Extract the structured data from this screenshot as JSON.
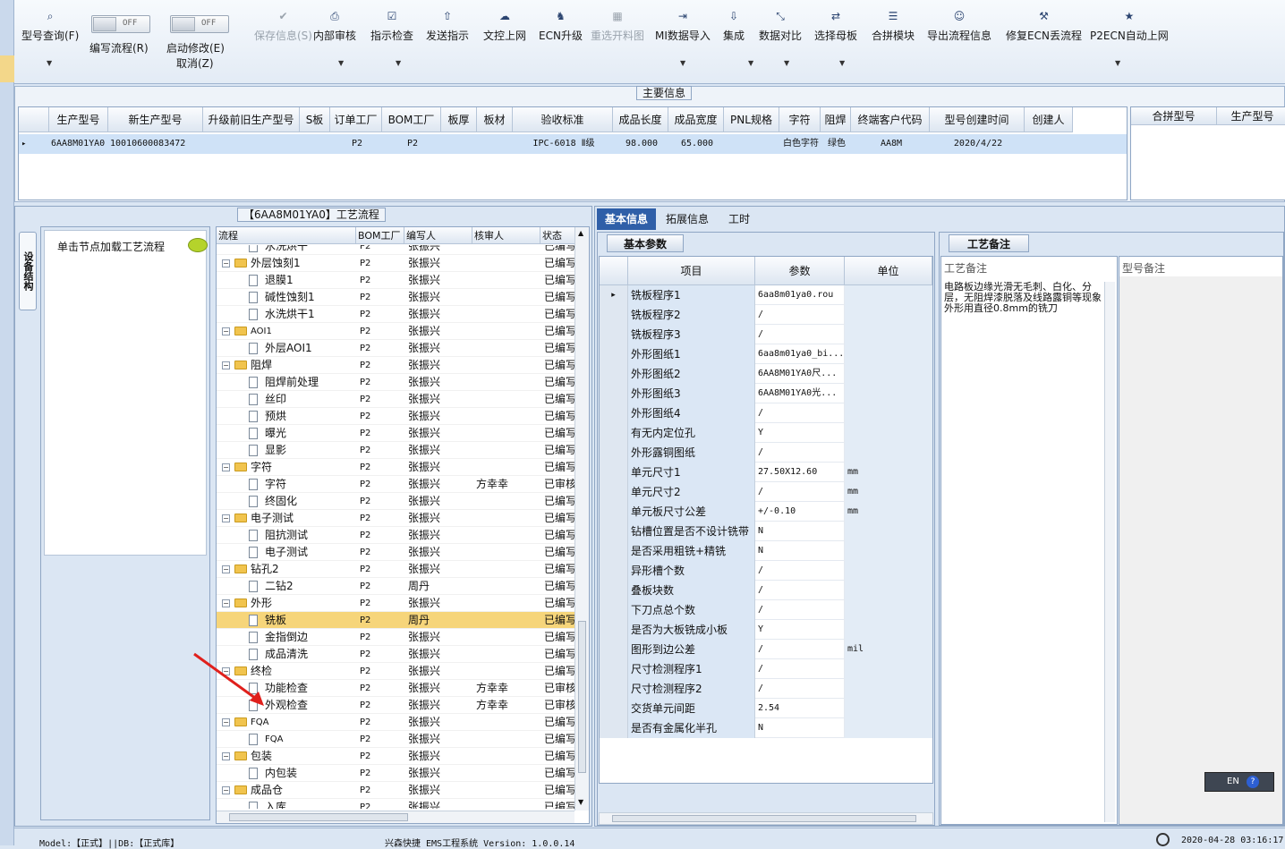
{
  "toolbar": {
    "items": [
      {
        "label": "型号查询(F)",
        "icon": "search-icon",
        "glyph": "⌕",
        "disabled": false,
        "dropdown": true
      },
      {
        "label": "保存信息(S)",
        "icon": "check-icon",
        "glyph": "✔",
        "disabled": true,
        "dropdown": false
      },
      {
        "label": "内部审核",
        "icon": "print-icon",
        "glyph": "⎙",
        "disabled": false,
        "dropdown": true
      },
      {
        "label": "指示检查",
        "icon": "checkbox-icon",
        "glyph": "☑",
        "disabled": false,
        "dropdown": true
      },
      {
        "label": "发送指示",
        "icon": "upload-icon",
        "glyph": "⇧",
        "disabled": false,
        "dropdown": false
      },
      {
        "label": "文控上网",
        "icon": "cloud-upload-icon",
        "glyph": "☁",
        "disabled": false,
        "dropdown": false
      },
      {
        "label": "ECN升级",
        "icon": "ecn-icon",
        "glyph": "♞",
        "disabled": false,
        "dropdown": false
      },
      {
        "label": "重选开料图",
        "icon": "image-icon",
        "glyph": "▦",
        "disabled": true,
        "dropdown": false
      },
      {
        "label": "MI数据导入",
        "icon": "import-icon",
        "glyph": "⇥",
        "disabled": false,
        "dropdown": true
      },
      {
        "label": "集成",
        "icon": "download-icon",
        "glyph": "⇩",
        "disabled": false,
        "dropdown": true
      },
      {
        "label": "数据对比",
        "icon": "compare-icon",
        "glyph": "⤡",
        "disabled": false,
        "dropdown": true
      },
      {
        "label": "选择母板",
        "icon": "shuffle-icon",
        "glyph": "⇄",
        "disabled": false,
        "dropdown": true
      },
      {
        "label": "合拼模块",
        "icon": "list-icon",
        "glyph": "☰",
        "disabled": false,
        "dropdown": false
      },
      {
        "label": "导出流程信息",
        "icon": "smile-icon",
        "glyph": "☺",
        "disabled": false,
        "dropdown": false
      },
      {
        "label": "修复ECN丢流程",
        "icon": "wrench-icon",
        "glyph": "⚒",
        "disabled": false,
        "dropdown": false
      },
      {
        "label": "P2ECN自动上网",
        "icon": "star-icon",
        "glyph": "★",
        "disabled": false,
        "dropdown": true
      }
    ],
    "toggle1": {
      "state": "OFF",
      "label": "编写流程(R)"
    },
    "toggle2": {
      "state": "OFF",
      "label": "启动修改(E)",
      "sub": "取消(Z)"
    }
  },
  "main_info": {
    "title": "主要信息",
    "columns": [
      "生产型号",
      "新生产型号",
      "升级前旧生产型号",
      "S板",
      "订单工厂",
      "BOM工厂",
      "板厚",
      "板材",
      "验收标准",
      "成品长度",
      "成品宽度",
      "PNL规格",
      "字符",
      "阻焊",
      "终端客户代码",
      "型号创建时间",
      "创建人"
    ],
    "row": [
      "6AA8M01YA0",
      "10010600083472",
      "",
      "",
      "P2",
      "P2",
      "",
      "",
      "IPC-6018 Ⅱ级",
      "98.000",
      "65.000",
      "",
      "白色字符",
      "绿色",
      "AA8M",
      "2020/4/22",
      ""
    ],
    "right_columns": [
      "合拼型号",
      "生产型号"
    ]
  },
  "flow": {
    "title": "【6AA8M01YA0】工艺流程",
    "side_tab": "设备结构",
    "hint": "单击节点加载工艺流程",
    "columns": [
      "流程",
      "BOM工厂",
      "编写人",
      "核审人",
      "状态"
    ],
    "rows": [
      {
        "name": "水洗烘干",
        "lvl": 2,
        "type": "doc",
        "bom": "P2",
        "writer": "张振兴",
        "checker": "",
        "status": "已编写"
      },
      {
        "name": "外层蚀刻1",
        "lvl": 1,
        "type": "folder",
        "bom": "P2",
        "writer": "张振兴",
        "checker": "",
        "status": "已编写"
      },
      {
        "name": "退膜1",
        "lvl": 2,
        "type": "doc",
        "bom": "P2",
        "writer": "张振兴",
        "checker": "",
        "status": "已编写"
      },
      {
        "name": "碱性蚀刻1",
        "lvl": 2,
        "type": "doc",
        "bom": "P2",
        "writer": "张振兴",
        "checker": "",
        "status": "已编写"
      },
      {
        "name": "水洗烘干1",
        "lvl": 2,
        "type": "doc",
        "bom": "P2",
        "writer": "张振兴",
        "checker": "",
        "status": "已编写"
      },
      {
        "name": "AOI1",
        "lvl": 1,
        "type": "folder",
        "bom": "P2",
        "writer": "张振兴",
        "checker": "",
        "status": "已编写"
      },
      {
        "name": "外层AOI1",
        "lvl": 2,
        "type": "doc",
        "bom": "P2",
        "writer": "张振兴",
        "checker": "",
        "status": "已编写"
      },
      {
        "name": "阻焊",
        "lvl": 1,
        "type": "folder",
        "bom": "P2",
        "writer": "张振兴",
        "checker": "",
        "status": "已编写"
      },
      {
        "name": "阻焊前处理",
        "lvl": 2,
        "type": "doc",
        "bom": "P2",
        "writer": "张振兴",
        "checker": "",
        "status": "已编写"
      },
      {
        "name": "丝印",
        "lvl": 2,
        "type": "doc",
        "bom": "P2",
        "writer": "张振兴",
        "checker": "",
        "status": "已编写"
      },
      {
        "name": "预烘",
        "lvl": 2,
        "type": "doc",
        "bom": "P2",
        "writer": "张振兴",
        "checker": "",
        "status": "已编写"
      },
      {
        "name": "曝光",
        "lvl": 2,
        "type": "doc",
        "bom": "P2",
        "writer": "张振兴",
        "checker": "",
        "status": "已编写"
      },
      {
        "name": "显影",
        "lvl": 2,
        "type": "doc",
        "bom": "P2",
        "writer": "张振兴",
        "checker": "",
        "status": "已编写"
      },
      {
        "name": "字符",
        "lvl": 1,
        "type": "folder",
        "bom": "P2",
        "writer": "张振兴",
        "checker": "",
        "status": "已编写"
      },
      {
        "name": "字符",
        "lvl": 2,
        "type": "doc",
        "bom": "P2",
        "writer": "张振兴",
        "checker": "方幸幸",
        "status": "已审核"
      },
      {
        "name": "终固化",
        "lvl": 2,
        "type": "doc",
        "bom": "P2",
        "writer": "张振兴",
        "checker": "",
        "status": "已编写"
      },
      {
        "name": "电子测试",
        "lvl": 1,
        "type": "folder",
        "bom": "P2",
        "writer": "张振兴",
        "checker": "",
        "status": "已编写"
      },
      {
        "name": "阻抗测试",
        "lvl": 2,
        "type": "doc",
        "bom": "P2",
        "writer": "张振兴",
        "checker": "",
        "status": "已编写"
      },
      {
        "name": "电子测试",
        "lvl": 2,
        "type": "doc",
        "bom": "P2",
        "writer": "张振兴",
        "checker": "",
        "status": "已编写"
      },
      {
        "name": "钻孔2",
        "lvl": 1,
        "type": "folder",
        "bom": "P2",
        "writer": "张振兴",
        "checker": "",
        "status": "已编写"
      },
      {
        "name": "二钻2",
        "lvl": 2,
        "type": "doc",
        "bom": "P2",
        "writer": "周丹",
        "checker": "",
        "status": "已编写"
      },
      {
        "name": "外形",
        "lvl": 1,
        "type": "folder",
        "bom": "P2",
        "writer": "张振兴",
        "checker": "",
        "status": "已编写"
      },
      {
        "name": "铣板",
        "lvl": 2,
        "type": "doc",
        "bom": "P2",
        "writer": "周丹",
        "checker": "",
        "status": "已编写",
        "selected": true
      },
      {
        "name": "金指倒边",
        "lvl": 2,
        "type": "doc",
        "bom": "P2",
        "writer": "张振兴",
        "checker": "",
        "status": "已编写"
      },
      {
        "name": "成品清洗",
        "lvl": 2,
        "type": "doc",
        "bom": "P2",
        "writer": "张振兴",
        "checker": "",
        "status": "已编写"
      },
      {
        "name": "终检",
        "lvl": 1,
        "type": "folder",
        "bom": "P2",
        "writer": "张振兴",
        "checker": "",
        "status": "已编写"
      },
      {
        "name": "功能检查",
        "lvl": 2,
        "type": "doc",
        "bom": "P2",
        "writer": "张振兴",
        "checker": "方幸幸",
        "status": "已审核"
      },
      {
        "name": "外观检查",
        "lvl": 2,
        "type": "doc",
        "bom": "P2",
        "writer": "张振兴",
        "checker": "方幸幸",
        "status": "已审核"
      },
      {
        "name": "FQA",
        "lvl": 1,
        "type": "folder",
        "bom": "P2",
        "writer": "张振兴",
        "checker": "",
        "status": "已编写"
      },
      {
        "name": "FQA",
        "lvl": 2,
        "type": "doc",
        "bom": "P2",
        "writer": "张振兴",
        "checker": "",
        "status": "已编写"
      },
      {
        "name": "包装",
        "lvl": 1,
        "type": "folder",
        "bom": "P2",
        "writer": "张振兴",
        "checker": "",
        "status": "已编写"
      },
      {
        "name": "内包装",
        "lvl": 2,
        "type": "doc",
        "bom": "P2",
        "writer": "张振兴",
        "checker": "",
        "status": "已编写"
      },
      {
        "name": "成品仓",
        "lvl": 1,
        "type": "folder",
        "bom": "P2",
        "writer": "张振兴",
        "checker": "",
        "status": "已编写"
      },
      {
        "name": "入库",
        "lvl": 2,
        "type": "doc",
        "bom": "P2",
        "writer": "张振兴",
        "checker": "",
        "status": "已编写"
      }
    ]
  },
  "right": {
    "tabs": [
      "基本信息",
      "拓展信息",
      "工时"
    ],
    "params_title": "基本参数",
    "param_columns": [
      "项目",
      "参数",
      "单位"
    ],
    "params": [
      [
        "铣板程序1",
        "6aa8m01ya0.rou",
        ""
      ],
      [
        "铣板程序2",
        "/",
        ""
      ],
      [
        "铣板程序3",
        "/",
        ""
      ],
      [
        "外形图纸1",
        "6aa8m01ya0_bi...",
        ""
      ],
      [
        "外形图纸2",
        "6AA8M01YA0尺...",
        ""
      ],
      [
        "外形图纸3",
        "6AA8M01YA0光...",
        ""
      ],
      [
        "外形图纸4",
        "/",
        ""
      ],
      [
        "有无内定位孔",
        "Y",
        ""
      ],
      [
        "外形露铜图纸",
        "/",
        ""
      ],
      [
        "单元尺寸1",
        "27.50X12.60",
        "mm"
      ],
      [
        "单元尺寸2",
        "/",
        "mm"
      ],
      [
        "单元板尺寸公差",
        "+/-0.10",
        "mm"
      ],
      [
        "钻槽位置是否不设计铣带",
        "N",
        ""
      ],
      [
        "是否采用粗铣+精铣",
        "N",
        ""
      ],
      [
        "异形槽个数",
        "/",
        ""
      ],
      [
        "叠板块数",
        "/",
        ""
      ],
      [
        "下刀点总个数",
        "/",
        ""
      ],
      [
        "是否为大板铣成小板",
        "Y",
        ""
      ],
      [
        "图形到边公差",
        "/",
        "mil"
      ],
      [
        "尺寸检测程序1",
        "/",
        ""
      ],
      [
        "尺寸检测程序2",
        "/",
        ""
      ],
      [
        "交货单元间距",
        "2.54",
        ""
      ],
      [
        "是否有金属化半孔",
        "N",
        ""
      ]
    ],
    "remark_title": "工艺备注",
    "remark_col1": "工艺备注",
    "remark_col2": "型号备注",
    "remark_text": "电路板边缘光滑无毛刺、白化、分层，无阻焊漆脱落及线路露铜等现象\n外形用直径0.8mm的铣刀"
  },
  "ime": {
    "lang": "EN",
    "help": "?"
  },
  "status": {
    "left": "Model:【正式】||DB:【正式库】",
    "center": "兴森快捷 EMS工程系统 Version: 1.0.0.14",
    "time": "2020-04-28 03:16:17"
  },
  "colors": {
    "accent": "#2f5fa8",
    "selected_row": "#f6d57a",
    "arrow": "#e0201c"
  }
}
